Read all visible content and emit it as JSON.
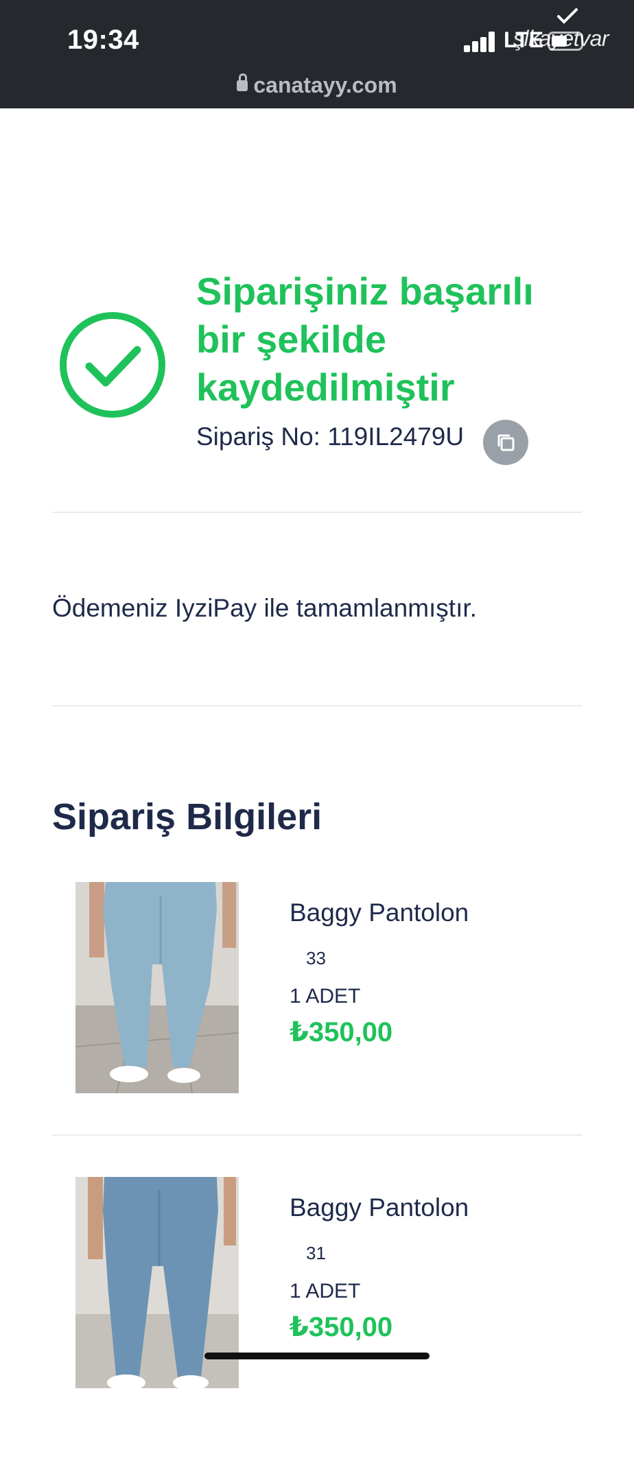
{
  "status_bar": {
    "time": "19:34",
    "network": "LTE"
  },
  "watermark": "şikayetvar",
  "url_bar": {
    "domain": "canatayy.com"
  },
  "confirmation": {
    "title": "Siparişiniz başarılı bir şekilde kaydedilmiştir",
    "order_label": "Sipariş No:",
    "order_number": "119IL2479U"
  },
  "payment_message": "Ödemeniz IyziPay ile tamamlanmıştır.",
  "order_info": {
    "title": "Sipariş Bilgileri",
    "items": [
      {
        "name": "Baggy Pantolon",
        "size": "33",
        "quantity": "1 ADET",
        "price": "₺350,00"
      },
      {
        "name": "Baggy Pantolon",
        "size": "31",
        "quantity": "1 ADET",
        "price": "₺350,00"
      }
    ]
  },
  "colors": {
    "accent_green": "#1fc25a",
    "text_navy": "#1f2a4a",
    "topbar_bg": "#25282c"
  }
}
